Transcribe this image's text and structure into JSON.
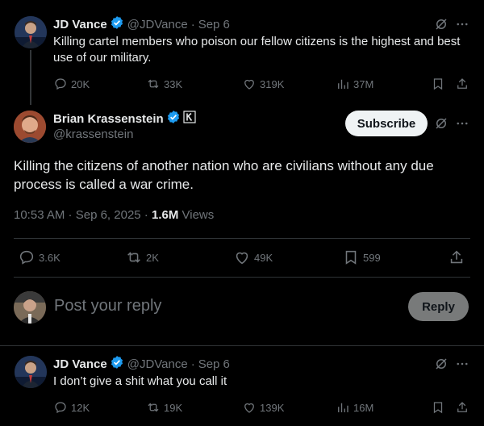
{
  "parent_tweet": {
    "name": "JD Vance",
    "handle": "@JDVance",
    "separator": "·",
    "date": "Sep 6",
    "text": "Killing cartel members who poison our fellow citizens is the highest and best use of our military.",
    "replies": "20K",
    "reposts": "33K",
    "likes": "319K",
    "views": "37M"
  },
  "main_tweet": {
    "name": "Brian Krassenstein",
    "handle": "@krassenstein",
    "subscribe_label": "Subscribe",
    "text": "Killing the citizens of another nation who are civilians without any due process is called a war crime.",
    "time": "10:53 AM",
    "date": "Sep 6, 2025",
    "views_count": "1.6M",
    "views_label": "Views",
    "replies": "3.6K",
    "reposts": "2K",
    "likes": "49K",
    "bookmarks": "599"
  },
  "composer": {
    "placeholder": "Post your reply",
    "reply_label": "Reply"
  },
  "reply_tweet": {
    "name": "JD Vance",
    "handle": "@JDVance",
    "separator": "·",
    "date": "Sep 6",
    "text": "I don’t give a shit what you call it",
    "replies": "12K",
    "reposts": "19K",
    "likes": "139K",
    "views": "16M"
  },
  "colors": {
    "verified": "#1d9bf0",
    "muted": "#71767b",
    "divider": "#2f3336"
  },
  "icons": [
    "verified-badge-icon",
    "grok-icon",
    "more-icon",
    "reply-icon",
    "repost-icon",
    "like-icon",
    "views-icon",
    "bookmark-icon",
    "share-icon",
    "affiliate-k-icon"
  ]
}
